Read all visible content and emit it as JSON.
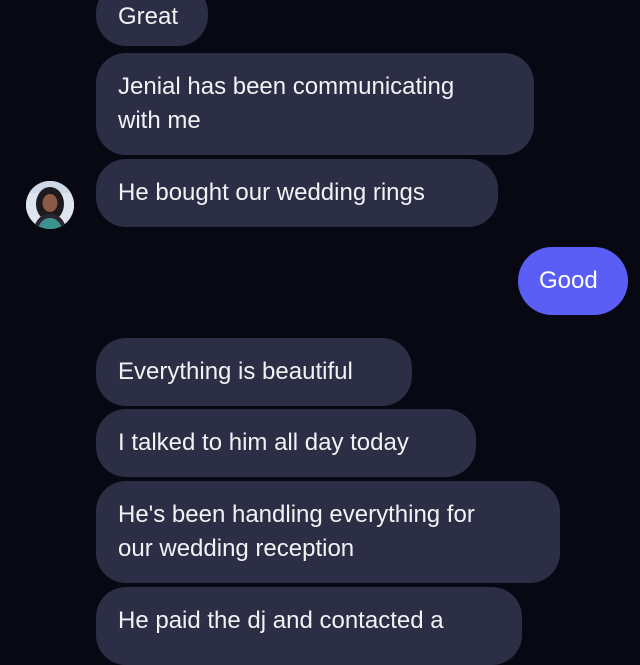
{
  "conversation": {
    "received": [
      "Great",
      "Jenial has been communicating\nwith me",
      "He bought our wedding rings",
      "Everything is beautiful",
      "I talked to him all day today",
      "He's been handling everything for\nour wedding reception",
      "He paid the dj and contacted a"
    ],
    "sent": [
      "Good"
    ]
  },
  "colors": {
    "background": "#070812",
    "received_bubble": "#2b2e45",
    "sent_bubble": "#5b5ef5"
  },
  "icons": {
    "avatar": "contact-avatar-icon"
  }
}
